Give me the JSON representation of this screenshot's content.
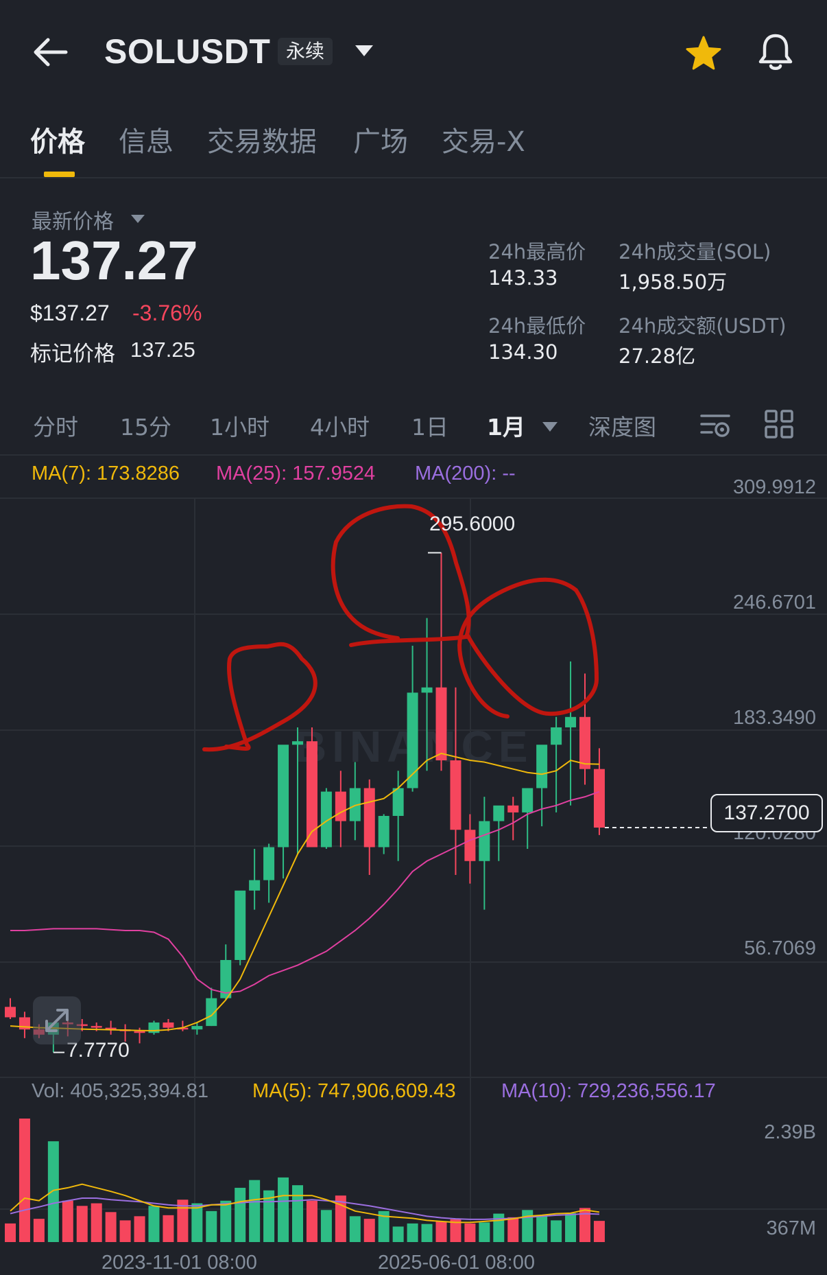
{
  "header": {
    "symbol": "SOLUSDT",
    "contract_type": "永续",
    "icons": [
      "back-arrow-icon",
      "chevron-down-icon",
      "star-icon",
      "bell-icon"
    ],
    "favorite_color": "#f0b90b"
  },
  "tabs": [
    {
      "label": "价格",
      "active": true
    },
    {
      "label": "信息",
      "active": false
    },
    {
      "label": "交易数据",
      "active": false
    },
    {
      "label": "广场",
      "active": false
    },
    {
      "label": "交易-X",
      "active": false
    }
  ],
  "ticker": {
    "last_price_label": "最新价格",
    "last_price": "137.27",
    "usd_price": "$137.27",
    "change_pct": "-3.76%",
    "mark_label": "标记价格",
    "mark_price": "137.25",
    "high_label": "24h最高价",
    "high": "143.33",
    "low_label": "24h最低价",
    "low": "134.30",
    "vol_sol_label": "24h成交量(SOL)",
    "vol_sol": "1,958.50万",
    "vol_usdt_label": "24h成交额(USDT)",
    "vol_usdt": "27.28亿"
  },
  "intervals": [
    {
      "label": "分时",
      "active": false
    },
    {
      "label": "15分",
      "active": false
    },
    {
      "label": "1小时",
      "active": false
    },
    {
      "label": "4小时",
      "active": false
    },
    {
      "label": "1日",
      "active": false
    },
    {
      "label": "1月",
      "active": true
    },
    {
      "label": "深度图",
      "active": false
    }
  ],
  "indicators": {
    "ma7": "MA(7): 173.8286",
    "ma25": "MA(25): 157.9524",
    "ma200": "MA(200): --",
    "vol": "Vol: 405,325,394.81",
    "vol_ma5": "MA(5): 747,906,609.43",
    "vol_ma10": "MA(10): 729,236,556.17"
  },
  "colors": {
    "up": "#2ebd85",
    "down": "#f6465d",
    "ma7": "#f0b90b",
    "ma25": "#e040a0",
    "ma200": "#9b6fe0",
    "annotation": "#c0160f"
  },
  "chart_data": {
    "type": "candlestick",
    "price_axis_labels": [
      "309.9912",
      "246.6701",
      "183.3490",
      "120.0280",
      "56.7069"
    ],
    "ylim": [
      -6.6,
      327
    ],
    "last_price_label": "137.2700",
    "high_marker_label": "295.6000",
    "low_marker_label": "7.7770",
    "volume_axis_labels": [
      "2.39B",
      "367M"
    ],
    "date_labels": [
      "2023-11-01 08:00",
      "2025-06-01 08:00"
    ],
    "candles": [
      [
        34.0,
        39.0,
        27.0,
        28.0
      ],
      [
        28.0,
        31.2,
        16.0,
        21.0
      ],
      [
        21.0,
        24.0,
        16.0,
        18.0
      ],
      [
        18.0,
        25.0,
        7.8,
        25.0
      ],
      [
        25.0,
        27.0,
        17.0,
        24.0
      ],
      [
        24.0,
        27.0,
        20.0,
        23.0
      ],
      [
        23.0,
        25.0,
        20.0,
        22.0
      ],
      [
        22.0,
        26.0,
        18.0,
        21.0
      ],
      [
        21.0,
        24.0,
        14.0,
        20.0
      ],
      [
        20.0,
        22.0,
        13.0,
        19.0
      ],
      [
        19.0,
        26.0,
        18.0,
        25.0
      ],
      [
        25.0,
        27.0,
        20.0,
        22.0
      ],
      [
        22.0,
        26.0,
        20.0,
        21.0
      ],
      [
        21.0,
        25.0,
        18.0,
        23.0
      ],
      [
        23.0,
        45.0,
        23.0,
        39.0
      ],
      [
        39.0,
        70.0,
        38.0,
        61.0
      ],
      [
        61.0,
        92.0,
        58.0,
        101.0
      ],
      [
        101.0,
        125.0,
        90.0,
        107.0
      ],
      [
        107.0,
        128.0,
        94.0,
        126.0
      ],
      [
        126.0,
        143.0,
        108.0,
        185.0
      ],
      [
        185.0,
        195.0,
        122.0,
        187.0
      ],
      [
        187.0,
        195.0,
        130.0,
        126.0
      ],
      [
        126.0,
        160.0,
        125.0,
        158.0
      ],
      [
        158.0,
        170.0,
        126.0,
        141.0
      ],
      [
        141.0,
        175.0,
        130.0,
        160.0
      ],
      [
        160.0,
        165.0,
        110.0,
        126.0
      ],
      [
        126.0,
        145.0,
        122.0,
        144.0
      ],
      [
        144.0,
        170.0,
        118.0,
        160.0
      ],
      [
        160.0,
        242.0,
        158.0,
        215.0
      ],
      [
        215.0,
        258.0,
        170.0,
        218.0
      ],
      [
        218.0,
        295.6,
        170.0,
        176.0
      ],
      [
        176.0,
        218.0,
        110.0,
        136.0
      ],
      [
        136.0,
        145.0,
        105.0,
        118.0
      ],
      [
        118.0,
        155.0,
        90.0,
        141.0
      ],
      [
        141.0,
        149.0,
        118.0,
        150.0
      ],
      [
        150.0,
        155.0,
        130.0,
        146.0
      ],
      [
        146.0,
        160.0,
        125.0,
        160.0
      ],
      [
        160.0,
        180.0,
        138.0,
        185.0
      ],
      [
        185.0,
        201.0,
        146.0,
        195.0
      ],
      [
        195.0,
        233.0,
        150.0,
        201.0
      ],
      [
        201.0,
        226.0,
        162.0,
        171.0
      ],
      [
        171.0,
        183.0,
        133.0,
        137.27
      ]
    ],
    "ma7": [
      23,
      22.5,
      22,
      21.8,
      21.5,
      21.2,
      21,
      20.8,
      20.6,
      20.4,
      20.3,
      20.8,
      22,
      25,
      29,
      38,
      50,
      68,
      86,
      104,
      122,
      135,
      141,
      146,
      150,
      152,
      154,
      160,
      168,
      176,
      180,
      178,
      176,
      175,
      173,
      171,
      169,
      168,
      170,
      176,
      174,
      173.8
    ],
    "ma25": [
      78,
      78,
      78.5,
      79,
      79,
      79,
      79,
      78.5,
      78,
      78,
      77,
      73,
      63,
      50,
      44,
      42,
      43,
      47,
      52,
      55,
      58,
      62,
      66,
      72,
      78,
      85,
      93,
      102,
      112,
      118,
      122,
      126,
      130,
      133,
      136,
      140,
      145,
      148,
      150,
      153,
      155,
      157.95
    ],
    "volumes": [
      0.36,
      2.39,
      0.45,
      1.95,
      0.8,
      0.7,
      0.75,
      0.58,
      0.42,
      0.5,
      0.7,
      0.52,
      0.82,
      0.75,
      0.6,
      0.8,
      1.05,
      1.2,
      1.0,
      1.25,
      1.1,
      0.8,
      0.62,
      0.9,
      0.5,
      0.45,
      0.6,
      0.3,
      0.36,
      0.35,
      0.4,
      0.44,
      0.36,
      0.38,
      0.55,
      0.48,
      0.62,
      0.5,
      0.42,
      0.56,
      0.66,
      0.41
    ],
    "volume_ma5": [
      0.6,
      0.85,
      0.8,
      1.0,
      1.05,
      1.12,
      1.05,
      0.98,
      0.9,
      0.8,
      0.7,
      0.66,
      0.66,
      0.66,
      0.72,
      0.72,
      0.78,
      0.82,
      0.85,
      0.9,
      0.9,
      0.9,
      0.82,
      0.72,
      0.6,
      0.55,
      0.5,
      0.48,
      0.46,
      0.42,
      0.4,
      0.38,
      0.38,
      0.4,
      0.42,
      0.45,
      0.5,
      0.52,
      0.55,
      0.56,
      0.62,
      0.58
    ],
    "volume_ma10": [
      0.55,
      0.62,
      0.68,
      0.75,
      0.8,
      0.85,
      0.85,
      0.82,
      0.8,
      0.78,
      0.75,
      0.72,
      0.7,
      0.7,
      0.72,
      0.74,
      0.76,
      0.78,
      0.78,
      0.79,
      0.8,
      0.82,
      0.8,
      0.78,
      0.74,
      0.7,
      0.65,
      0.6,
      0.55,
      0.5,
      0.47,
      0.45,
      0.44,
      0.44,
      0.45,
      0.46,
      0.48,
      0.5,
      0.52,
      0.53,
      0.55,
      0.54
    ]
  }
}
